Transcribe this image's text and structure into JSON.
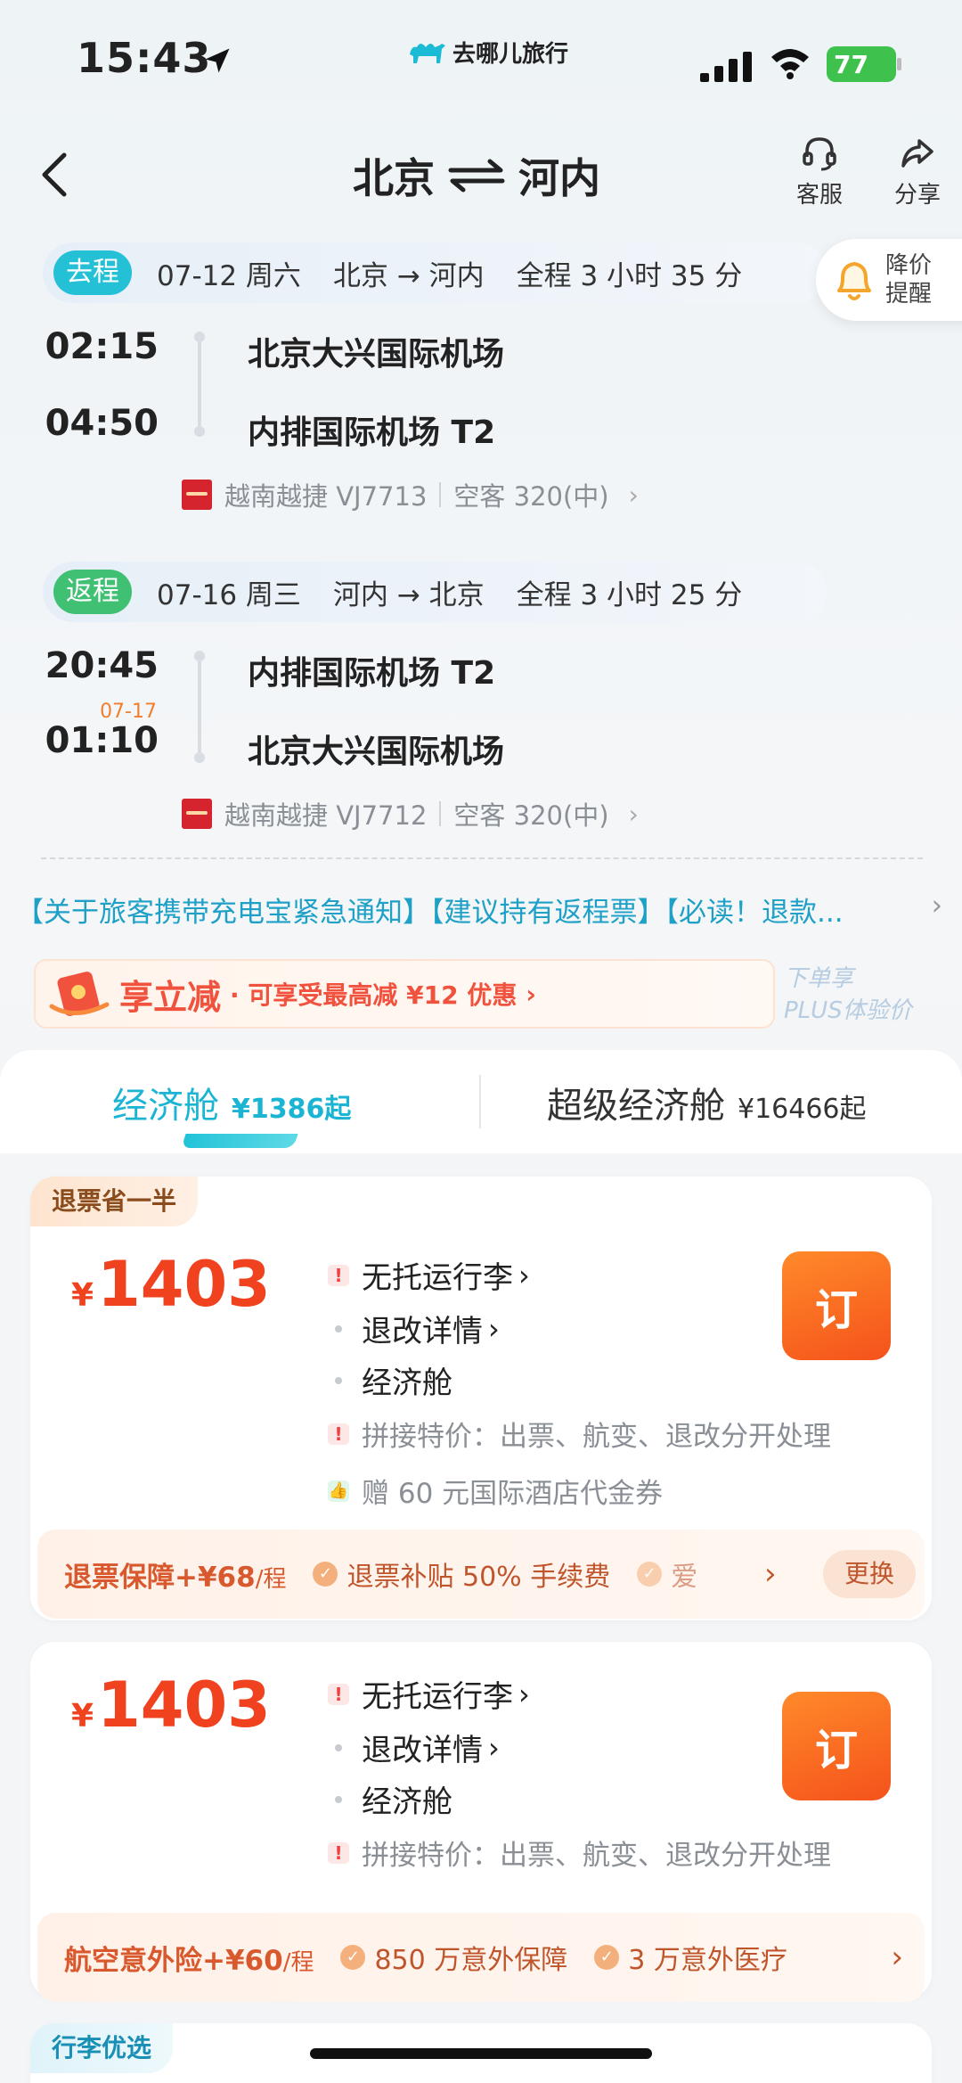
{
  "status": {
    "time": "15:43",
    "brand": "去哪儿旅行",
    "battery": "77"
  },
  "nav": {
    "from": "北京",
    "to": "河内",
    "service_label": "客服",
    "share_label": "分享"
  },
  "price_alert": {
    "line1": "降价",
    "line2": "提醒"
  },
  "outbound": {
    "tag": "去程",
    "date": "07-12 周六",
    "route": "北京 → 河内",
    "duration": "全程 3 小时 35 分",
    "dep_time": "02:15",
    "arr_time": "04:50",
    "dep_airport": "北京大兴国际机场",
    "arr_airport": "内排国际机场 T2",
    "flight": "越南越捷 VJ7713",
    "aircraft": "空客 320(中)"
  },
  "return": {
    "tag": "返程",
    "date": "07-16 周三",
    "route": "河内 → 北京",
    "duration": "全程 3 小时 25 分",
    "dep_time": "20:45",
    "arr_date": "07-17",
    "arr_time": "01:10",
    "dep_airport": "内排国际机场 T2",
    "arr_airport": "北京大兴国际机场",
    "flight": "越南越捷 VJ7712",
    "aircraft": "空客 320(中)"
  },
  "notice": "【关于旅客携带充电宝紧急通知】【建议持有返程票】【必读！退款...",
  "promo": {
    "title": "享立减",
    "desc": "· 可享受最高减 ¥12 优惠",
    "plus_line1": "下单享",
    "plus_line2": "PLUS体验价"
  },
  "cabins": [
    {
      "name": "经济舱",
      "price": "¥1386起"
    },
    {
      "name": "超级经济舱",
      "price": "¥16466起"
    }
  ],
  "offers": [
    {
      "ribbon": "退票省一半",
      "price": "1403",
      "features": [
        "无托运行李",
        "退改详情",
        "经济舱"
      ],
      "note": "拼接特价：出票、航变、退改分开处理",
      "gift": "赠 60 元国际酒店代金券",
      "book": "订",
      "insurance": {
        "name": "退票保障",
        "price": "+¥68",
        "unit": "/程",
        "items": [
          "退票补贴 50% 手续费",
          "爱"
        ],
        "change": "更换"
      }
    },
    {
      "price": "1403",
      "features": [
        "无托运行李",
        "退改详情",
        "经济舱"
      ],
      "note": "拼接特价：出票、航变、退改分开处理",
      "book": "订",
      "insurance": {
        "name": "航空意外险",
        "price": "+¥60",
        "unit": "/程",
        "items": [
          "850 万意外保障",
          "3 万意外医疗"
        ]
      }
    }
  ],
  "baggage_ribbon": "行李优选",
  "colors": {
    "accent": "#1bb4d3",
    "price": "#f0421f",
    "book": "#f5521b"
  }
}
